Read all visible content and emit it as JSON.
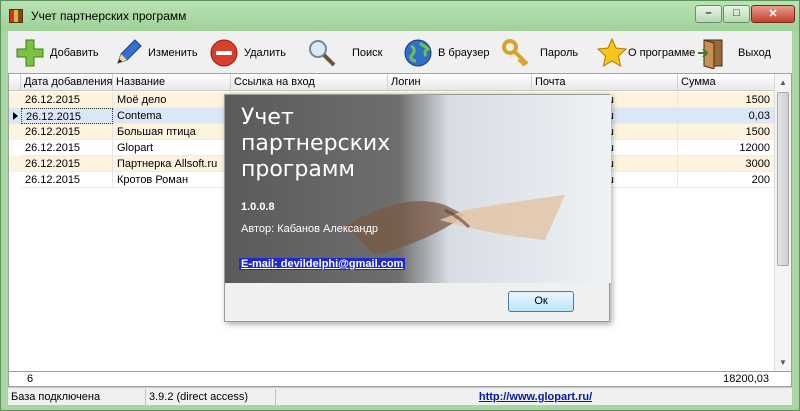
{
  "window": {
    "title": "Учет партнерских программ"
  },
  "toolbar": {
    "add": "Добавить",
    "edit": "Изменить",
    "delete": "Удалить",
    "search": "Поиск",
    "browser": "В браузер",
    "password": "Пароль",
    "about": "О программе",
    "exit": "Выход"
  },
  "grid": {
    "columns": [
      "Дата добавления",
      "Название",
      "Ссылка на вход",
      "Логин",
      "Почта",
      "Сумма"
    ],
    "rows": [
      {
        "date": "26.12.2015",
        "name": "Моё дело",
        "mail": "ail.ru",
        "sum": "1500"
      },
      {
        "date": "26.12.2015",
        "name": "Contema",
        "mail": "ail.ru",
        "sum": "0,03"
      },
      {
        "date": "26.12.2015",
        "name": "Большая птица",
        "mail": "ail.ru",
        "sum": "1500"
      },
      {
        "date": "26.12.2015",
        "name": "Glopart",
        "mail": "ail.ru",
        "sum": "12000"
      },
      {
        "date": "26.12.2015",
        "name": "Партнерка Allsoft.ru",
        "mail": "ail.ru",
        "sum": "3000"
      },
      {
        "date": "26.12.2015",
        "name": "Кротов Роман",
        "mail": "ail.ru",
        "sum": "200"
      }
    ],
    "footer_count": "6",
    "footer_total": "18200,03"
  },
  "statusbar": {
    "connection": "База подключена",
    "version": "3.9.2 (direct access)",
    "link": "http://www.glopart.ru/"
  },
  "about": {
    "title": "Учет партнерских программ",
    "version": "1.0.0.8",
    "author": "Автор: Кабанов Александр",
    "email": "E-mail: devildelphi@gmail.com",
    "ok": "Ок"
  }
}
